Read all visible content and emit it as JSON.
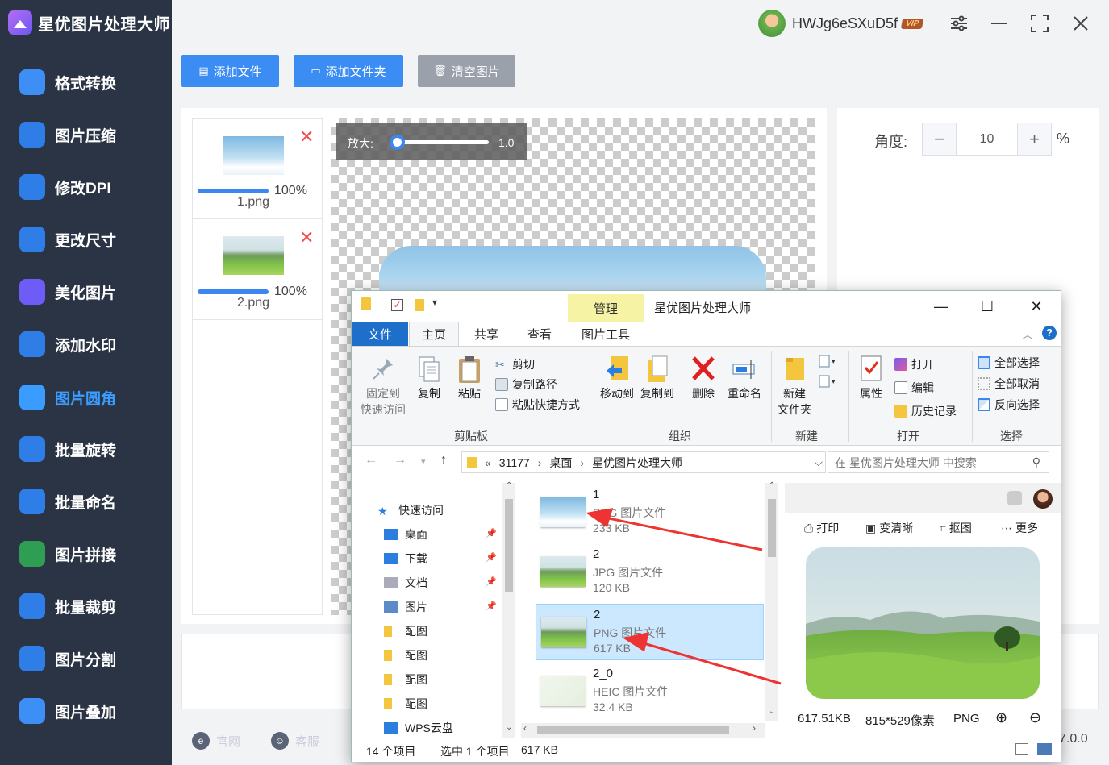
{
  "app": {
    "title": "星优图片处理大师",
    "user": "HWJg6eSXuD5f",
    "vip_badge": "VIP",
    "version": "7.0.0"
  },
  "colors": {
    "sidebar_bg": "#2b3444",
    "accent": "#3b86f0",
    "delete": "#f05050",
    "manage_tab": "#f6f3a4"
  },
  "sidebar": {
    "items": [
      {
        "label": "格式转换",
        "icon": "format-convert-icon",
        "color": "#3d8ef5"
      },
      {
        "label": "图片压缩",
        "icon": "compress-icon",
        "color": "#2f7ee8"
      },
      {
        "label": "修改DPI",
        "icon": "dpi-icon",
        "color": "#2f7ee8"
      },
      {
        "label": "更改尺寸",
        "icon": "resize-icon",
        "color": "#2f7ee8"
      },
      {
        "label": "美化图片",
        "icon": "beautify-icon",
        "color": "#6d5cf5"
      },
      {
        "label": "添加水印",
        "icon": "watermark-icon",
        "color": "#2f7ee8"
      },
      {
        "label": "图片圆角",
        "icon": "rounded-corner-icon",
        "color": "#3b9cff"
      },
      {
        "label": "批量旋转",
        "icon": "rotate-icon",
        "color": "#2f7ee8"
      },
      {
        "label": "批量命名",
        "icon": "rename-icon",
        "color": "#2f7ee8"
      },
      {
        "label": "图片拼接",
        "icon": "puzzle-icon",
        "color": "#2f9e52"
      },
      {
        "label": "批量裁剪",
        "icon": "crop-icon",
        "color": "#2f7ee8"
      },
      {
        "label": "图片分割",
        "icon": "split-icon",
        "color": "#2f7ee8"
      },
      {
        "label": "图片叠加",
        "icon": "layers-icon",
        "color": "#3d8ef5"
      }
    ],
    "active_index": 6,
    "footer": [
      {
        "label": "官网",
        "icon": "website-icon"
      },
      {
        "label": "客服",
        "icon": "support-icon"
      }
    ]
  },
  "toolbar": {
    "add_file": "添加文件",
    "add_folder": "添加文件夹",
    "clear": "清空图片"
  },
  "files": [
    {
      "name": "1.png",
      "progress": "100%"
    },
    {
      "name": "2.png",
      "progress": "100%"
    }
  ],
  "zoom": {
    "label": "放大:",
    "value": "1.0",
    "level": 0.0
  },
  "angle": {
    "label": "角度:",
    "value": "10",
    "minus": "−",
    "plus": "+",
    "unit": "%"
  },
  "explorer": {
    "manage_tab": "管理",
    "title": "星优图片处理大师",
    "tabs": {
      "file": "文件",
      "home": "主页",
      "share": "共享",
      "view": "查看",
      "picture_tools": "图片工具"
    },
    "ribbon": {
      "pin_line1": "固定到",
      "pin_line2": "快速访问",
      "copy": "复制",
      "paste": "粘贴",
      "cut": "剪切",
      "copy_path": "复制路径",
      "paste_shortcut": "粘贴快捷方式",
      "move_to": "移动到",
      "copy_to": "复制到",
      "delete": "删除",
      "rename": "重命名",
      "new_folder_line1": "新建",
      "new_folder_line2": "文件夹",
      "properties": "属性",
      "open": "打开",
      "edit": "编辑",
      "history": "历史记录",
      "select_all": "全部选择",
      "select_none": "全部取消",
      "invert": "反向选择",
      "groups": {
        "clipboard": "剪贴板",
        "organize": "组织",
        "new": "新建",
        "open": "打开",
        "select": "选择"
      }
    },
    "address": {
      "prefix": "«",
      "path": [
        "31177",
        "桌面",
        "星优图片处理大师"
      ],
      "search_placeholder": "在 星优图片处理大师 中搜索"
    },
    "nav": [
      {
        "label": "快速访问",
        "icon": "star-icon",
        "pinned": false
      },
      {
        "label": "桌面",
        "icon": "desktop-icon",
        "pinned": true
      },
      {
        "label": "下载",
        "icon": "download-icon",
        "pinned": true
      },
      {
        "label": "文档",
        "icon": "document-icon",
        "pinned": true
      },
      {
        "label": "图片",
        "icon": "pictures-icon",
        "pinned": true
      },
      {
        "label": "配图",
        "icon": "folder-icon",
        "pinned": false
      },
      {
        "label": "配图",
        "icon": "folder-icon",
        "pinned": false
      },
      {
        "label": "配图",
        "icon": "folder-icon",
        "pinned": false
      },
      {
        "label": "配图",
        "icon": "folder-icon",
        "pinned": false
      },
      {
        "label": "WPS云盘",
        "icon": "cloud-icon",
        "pinned": false
      }
    ],
    "file_rows": [
      {
        "name": "1",
        "type": "PNG 图片文件",
        "size": "233 KB",
        "selected": false
      },
      {
        "name": "2",
        "type": "JPG 图片文件",
        "size": "120 KB",
        "selected": false
      },
      {
        "name": "2",
        "type": "PNG 图片文件",
        "size": "617 KB",
        "selected": true
      },
      {
        "name": "2_0",
        "type": "HEIC 图片文件",
        "size": "32.4 KB",
        "selected": false
      }
    ],
    "preview": {
      "tools": [
        "打印",
        "变清晰",
        "抠图",
        "更多"
      ],
      "info": [
        "617.51KB",
        "815*529像素",
        "PNG"
      ]
    },
    "status": {
      "count": "14 个项目",
      "selected": "选中 1 个项目",
      "size": "617 KB"
    }
  }
}
